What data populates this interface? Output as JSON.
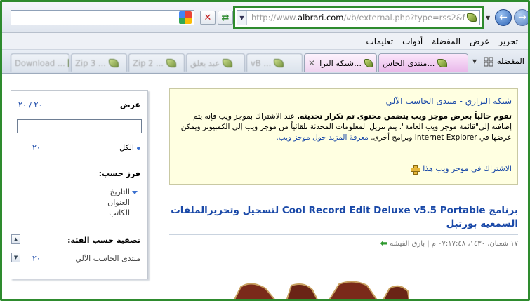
{
  "address": {
    "url_prefix": "http://www.",
    "url_domain": "albrari.com",
    "url_path": "/vb/external.php?type=rss2&f"
  },
  "menu": {
    "items": [
      "تحرير",
      "عرض",
      "المفضلة",
      "أدوات",
      "تعليمات"
    ]
  },
  "tabs": {
    "favorites_label": "المفضلة",
    "items": [
      {
        "label": "منتدى الحاس..."
      },
      {
        "label": "شبكة البرا..."
      },
      {
        "label": "vB ..."
      },
      {
        "label": "عبد يعلق"
      },
      {
        "label": "Zip 2 ..."
      },
      {
        "label": "Zip 3 ..."
      },
      {
        "label": "Download ..."
      }
    ]
  },
  "panel": {
    "display_label": "عرض",
    "display_count": "٢٠ / ٢٠",
    "all_label": "الكل",
    "all_count": "٢٠",
    "sort_label": "فرز حسب:",
    "sort_options": [
      "التاريخ",
      "العنوان",
      "الكاتب"
    ],
    "filter_label": "تصفية حسب الفئة:",
    "category_name": "منتدى الحاسب الآلي",
    "category_count": "٢٠"
  },
  "feed_info": {
    "title": "شبكة البراري - منتدى الحاسب الآلي",
    "body_bold": "تقوم حالياً بعرض موجز ويب يتضمن محتوى تم تكرار تحديثه.",
    "body_rest": " عند الاشتراك بموجز ويب فإنه يتم إضافته إلى\"قائمة موجز ويب العامة\". يتم تنزيل المعلومات المحدثة تلقائياً من موجز ويب إلى الكمبيوتر ويمكن عرضها في Internet Explorer وبرامج أخرى.",
    "learn_more": " معرفة المزيد حول موجز ويب.",
    "subscribe": "الاشتراك في موجز ويب هذا"
  },
  "post": {
    "title": "برنامج Cool Record Edit Deluxe v5.5 Portable لتسجيل وتحريرالملفات السمعية بورتبل",
    "meta": "١٧ شعبان، ١٤٣٠، ٠٧:١٧:٤٨ م | بارق الفيشه"
  },
  "colors": {
    "frame_green": "#2e8b2e",
    "link_blue": "#1a49a8",
    "info_bg": "#ffffe1"
  }
}
